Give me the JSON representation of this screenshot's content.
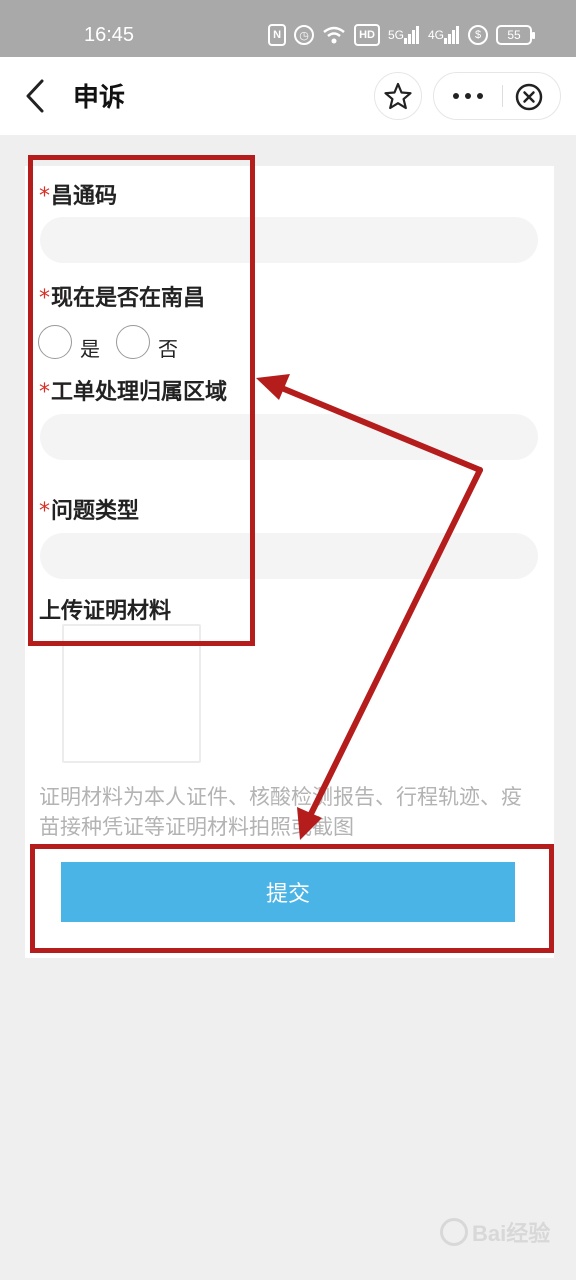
{
  "status_bar": {
    "time": "16:45",
    "icons": [
      "nfc-icon",
      "alarm-icon",
      "wifi-icon",
      "hd-icon",
      "signal-5g-icon",
      "signal-4g-icon",
      "shield-icon",
      "battery-icon"
    ],
    "hd_label": "HD",
    "signal_5g_label": "5G",
    "signal_4g_label": "4G",
    "battery": "55"
  },
  "nav": {
    "title": "申诉"
  },
  "form": {
    "fields": [
      {
        "label": "昌通码",
        "required_mark": "*"
      },
      {
        "label": "现在是否在南昌",
        "required_mark": "*"
      },
      {
        "label": "工单处理归属区域",
        "required_mark": "*"
      },
      {
        "label": "问题类型",
        "required_mark": "*"
      },
      {
        "label": "上传证明材料"
      }
    ],
    "radio_options": [
      "是",
      "否"
    ],
    "hint": "证明材料为本人证件、核酸检测报告、行程轨迹、疫苗接种凭证等证明材料拍照或截图",
    "submit_label": "提交"
  },
  "colors": {
    "accent": "#4ab4e7",
    "required": "#d93025",
    "annotation": "#b51d1d",
    "status_bar": "#a9a9a9"
  },
  "watermark": "Bai经验"
}
